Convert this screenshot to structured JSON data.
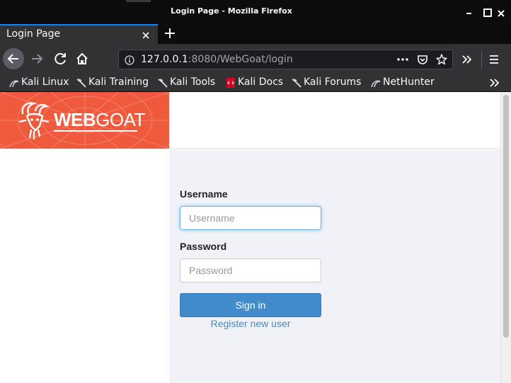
{
  "window": {
    "title": "Login Page - Mozilla Firefox"
  },
  "tabs": [
    {
      "label": "Login Page",
      "active": true
    }
  ],
  "toolbar": {
    "url_host": "127.0.0.1",
    "url_rest": ":8080/WebGoat/login",
    "icons": [
      "back-icon",
      "forward-icon",
      "reload-icon",
      "home-icon",
      "info-icon",
      "more-icon",
      "pocket-icon",
      "star-icon",
      "overflow-icon",
      "menu-icon"
    ]
  },
  "bookmarks": [
    {
      "label": "Kali Linux",
      "icon": "kali-icon"
    },
    {
      "label": "Kali Training",
      "icon": "kali-icon"
    },
    {
      "label": "Kali Tools",
      "icon": "kali-icon"
    },
    {
      "label": "Kali Docs",
      "icon": "docs-icon"
    },
    {
      "label": "Kali Forums",
      "icon": "kali-icon"
    },
    {
      "label": "NetHunter",
      "icon": "nethunter-icon"
    }
  ],
  "brand": {
    "wordmark_bold": "WEB",
    "wordmark_thin": "GOAT",
    "color": "#ef5a3d"
  },
  "login": {
    "username_label": "Username",
    "username_placeholder": "Username",
    "password_label": "Password",
    "password_placeholder": "Password",
    "signin_label": "Sign in",
    "register_label": "Register new user"
  },
  "colors": {
    "accent": "#428bca",
    "tab_highlight": "#0a84ff",
    "page_bg": "#f1f2f7"
  }
}
